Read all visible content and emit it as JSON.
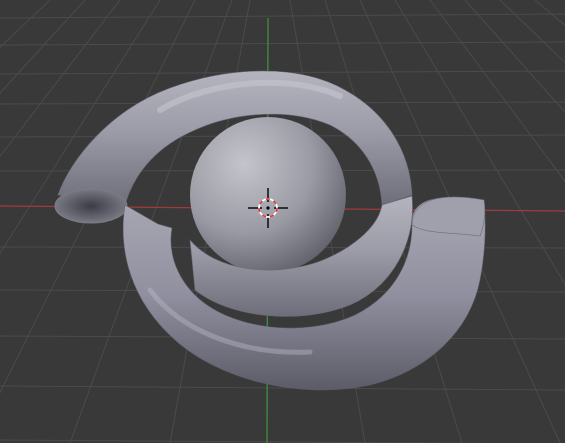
{
  "viewport": {
    "view": "3d-viewport",
    "background_color": "#393939",
    "grid_color": "#4a4a4a",
    "x_axis_color": "#a13b3b",
    "y_axis_color": "#3f8f3f",
    "object": {
      "name": "spiral-tube-mesh",
      "shading": "solid",
      "base_color": "#9a9aa6"
    },
    "cursor": {
      "icon": "3d-cursor-icon",
      "ring_color_a": "#d94040",
      "ring_color_b": "#ffffff"
    }
  }
}
